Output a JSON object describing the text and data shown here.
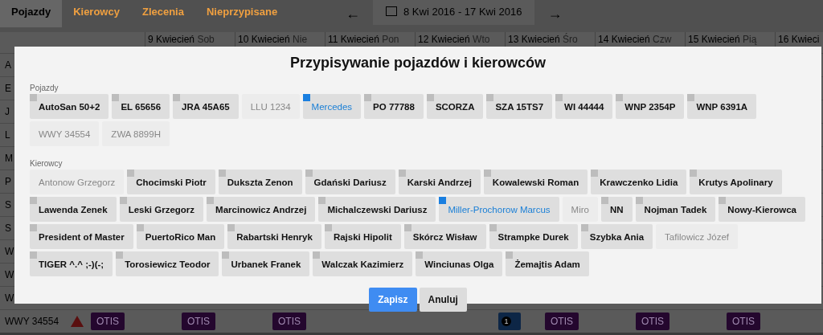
{
  "tabs": [
    {
      "label": "Pojazdy",
      "selected": true
    },
    {
      "label": "Kierowcy",
      "selected": false
    },
    {
      "label": "Zlecenia",
      "selected": false
    },
    {
      "label": "Nieprzypisane",
      "selected": false
    }
  ],
  "date_nav": {
    "prev": "←",
    "range": "8 Kwi 2016 - 17 Kwi 2016",
    "next": "→"
  },
  "timeline": {
    "days": [
      {
        "date": "9 Kwiecień",
        "weekday": "Sob"
      },
      {
        "date": "10 Kwiecień",
        "weekday": "Nie"
      },
      {
        "date": "11 Kwiecień",
        "weekday": "Pon"
      },
      {
        "date": "12 Kwiecień",
        "weekday": "Wto"
      },
      {
        "date": "13 Kwiecień",
        "weekday": "Śro"
      },
      {
        "date": "14 Kwiecień",
        "weekday": "Czw"
      },
      {
        "date": "15 Kwiecień",
        "weekday": "Pią"
      },
      {
        "date": "16 Kwieci"
      }
    ],
    "rows": [
      {
        "label": "A"
      },
      {
        "label": "E"
      },
      {
        "label": "J"
      },
      {
        "label": "L"
      },
      {
        "label": "M"
      },
      {
        "label": "P"
      },
      {
        "label": "S"
      },
      {
        "label": "S"
      },
      {
        "label": "W"
      },
      {
        "label": "W"
      },
      {
        "label": "W"
      },
      {
        "label": "WWY 34554",
        "warning": true,
        "events": [
          {
            "kind": "order",
            "label": "OTIS"
          },
          {
            "kind": "order",
            "label": "OTIS"
          },
          {
            "kind": "order",
            "label": "OTIS"
          },
          {
            "kind": "badge",
            "label": "1"
          },
          {
            "kind": "order",
            "label": "OTIS"
          },
          {
            "kind": "order",
            "label": "OTIS"
          },
          {
            "kind": "order",
            "label": "OTIS"
          }
        ]
      }
    ]
  },
  "modal": {
    "title": "Przypisywanie pojazdów i kierowców",
    "sections": [
      {
        "label": "Pojazdy",
        "items": [
          {
            "label": "AutoSan 50+2",
            "selected": false,
            "disabled": false
          },
          {
            "label": "EL 65656",
            "selected": false,
            "disabled": false
          },
          {
            "label": "JRA 45A65",
            "selected": false,
            "disabled": false
          },
          {
            "label": "LLU 1234",
            "selected": false,
            "disabled": true
          },
          {
            "label": "Mercedes",
            "selected": true,
            "disabled": false
          },
          {
            "label": "PO 77788",
            "selected": false,
            "disabled": false
          },
          {
            "label": "SCORZA",
            "selected": false,
            "disabled": false
          },
          {
            "label": "SZA 15TS7",
            "selected": false,
            "disabled": false
          },
          {
            "label": "WI 44444",
            "selected": false,
            "disabled": false
          },
          {
            "label": "WNP 2354P",
            "selected": false,
            "disabled": false
          },
          {
            "label": "WNP 6391A",
            "selected": false,
            "disabled": false
          },
          {
            "label": "WWY 34554",
            "selected": false,
            "disabled": true
          },
          {
            "label": "ZWA 8899H",
            "selected": false,
            "disabled": true
          }
        ]
      },
      {
        "label": "Kierowcy",
        "items": [
          {
            "label": "Antonow Grzegorz",
            "selected": false,
            "disabled": true
          },
          {
            "label": "Chocimski Piotr",
            "selected": false,
            "disabled": false
          },
          {
            "label": "Dukszta Zenon",
            "selected": false,
            "disabled": false
          },
          {
            "label": "Gdański Dariusz",
            "selected": false,
            "disabled": false
          },
          {
            "label": "Karski Andrzej",
            "selected": false,
            "disabled": false
          },
          {
            "label": "Kowalewski Roman",
            "selected": false,
            "disabled": false
          },
          {
            "label": "Krawczenko Lidia",
            "selected": false,
            "disabled": false
          },
          {
            "label": "Krutys Apolinary",
            "selected": false,
            "disabled": false
          },
          {
            "label": "Lawenda Zenek",
            "selected": false,
            "disabled": false
          },
          {
            "label": "Leski Grzegorz",
            "selected": false,
            "disabled": false
          },
          {
            "label": "Marcinowicz Andrzej",
            "selected": false,
            "disabled": false
          },
          {
            "label": "Michalczewski Dariusz",
            "selected": false,
            "disabled": false
          },
          {
            "label": "Miller-Prochorow Marcus",
            "selected": true,
            "disabled": false
          },
          {
            "label": "Miro",
            "selected": false,
            "disabled": true
          },
          {
            "label": "NN",
            "selected": false,
            "disabled": false
          },
          {
            "label": "Nojman Tadek",
            "selected": false,
            "disabled": false
          },
          {
            "label": "Nowy-Kierowca",
            "selected": false,
            "disabled": false
          },
          {
            "label": "President of Master",
            "selected": false,
            "disabled": false
          },
          {
            "label": "PuertoRico Man",
            "selected": false,
            "disabled": false
          },
          {
            "label": "Rabartski Henryk",
            "selected": false,
            "disabled": false
          },
          {
            "label": "Rajski Hipolit",
            "selected": false,
            "disabled": false
          },
          {
            "label": "Skórcz Wisław",
            "selected": false,
            "disabled": false
          },
          {
            "label": "Strampke Durek",
            "selected": false,
            "disabled": false
          },
          {
            "label": "Szybka Ania",
            "selected": false,
            "disabled": false
          },
          {
            "label": "Tafilowicz Józef",
            "selected": false,
            "disabled": true
          },
          {
            "label": "TIGER ^.^ ;-)(-;",
            "selected": false,
            "disabled": false
          },
          {
            "label": "Torosiewicz Teodor",
            "selected": false,
            "disabled": false
          },
          {
            "label": "Urbanek Franek",
            "selected": false,
            "disabled": false
          },
          {
            "label": "Walczak Kazimierz",
            "selected": false,
            "disabled": false
          },
          {
            "label": "Winciunas Olga",
            "selected": false,
            "disabled": false
          },
          {
            "label": "Żemajtis Adam",
            "selected": false,
            "disabled": false
          }
        ]
      }
    ],
    "buttons": [
      {
        "label": "Zapisz",
        "kind": "primary"
      },
      {
        "label": "Anuluj",
        "kind": "secondary"
      }
    ]
  }
}
